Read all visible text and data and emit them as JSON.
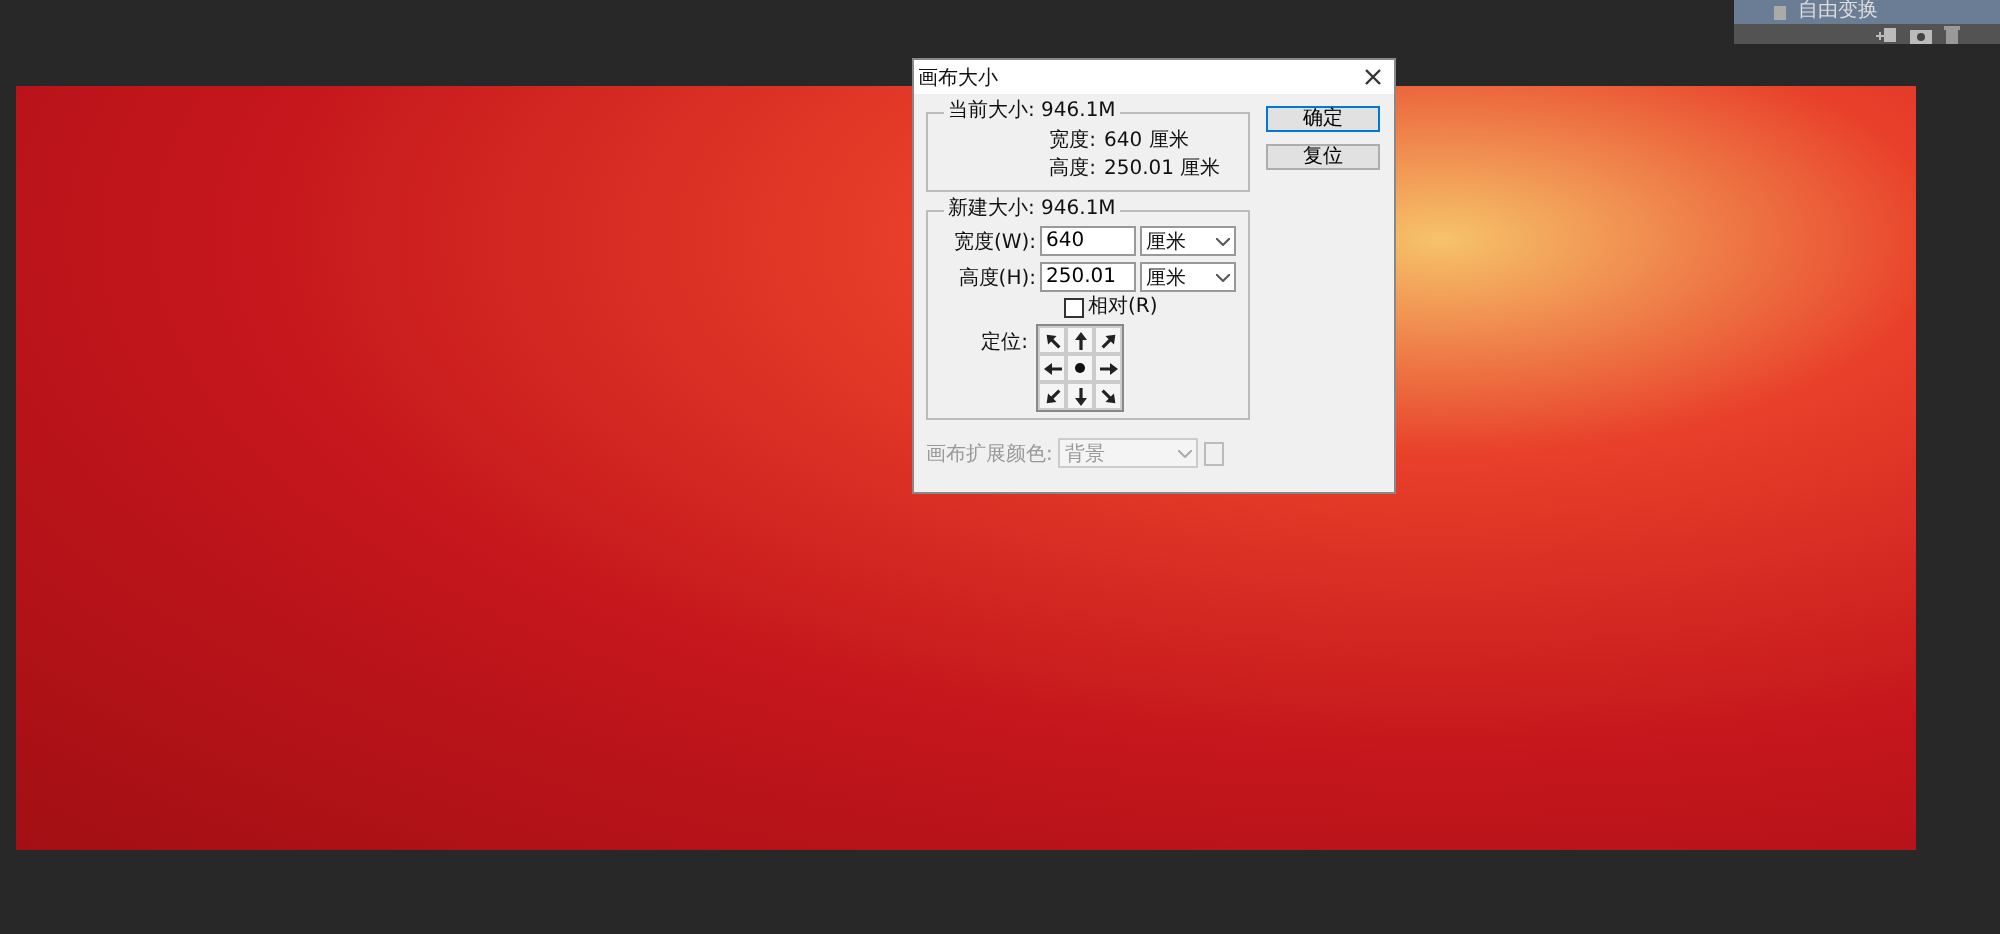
{
  "panel": {
    "history_item": "自由变换"
  },
  "dialog": {
    "title": "画布大小",
    "current": {
      "legend": "当前大小: 946.1M",
      "rows": [
        {
          "label": "宽度:",
          "value": "640 厘米"
        },
        {
          "label": "高度:",
          "value": "250.01 厘米"
        }
      ]
    },
    "new": {
      "legend": "新建大小: 946.1M",
      "fields": [
        {
          "label": "宽度(W):",
          "value": "640",
          "unit": "厘米"
        },
        {
          "label": "高度(H):",
          "value": "250.01",
          "unit": "厘米"
        }
      ],
      "relative": {
        "label": "相对(R)",
        "checked": false
      },
      "anchor_label": "定位:",
      "anchor": [
        {
          "selected": false
        },
        {
          "selected": false
        },
        {
          "selected": false
        },
        {
          "selected": false
        },
        {
          "selected": true
        },
        {
          "selected": false
        },
        {
          "selected": false
        },
        {
          "selected": false
        },
        {
          "selected": false
        }
      ]
    },
    "buttons": [
      {
        "label": "确定",
        "default": true
      },
      {
        "label": "复位",
        "default": false
      }
    ],
    "extension": {
      "label": "画布扩展颜色:",
      "value": "背景",
      "disabled": true
    }
  }
}
